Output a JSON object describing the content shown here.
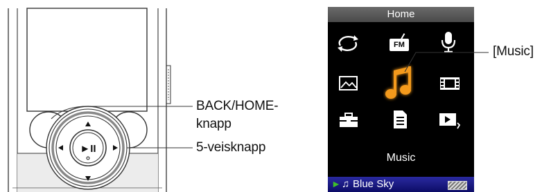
{
  "device": {
    "back_home_label": "BACK/HOME-",
    "back_home_label_line2": "knapp",
    "five_way_label": "5-veisknapp",
    "play_pause_symbol": "►II"
  },
  "screen": {
    "title": "Home",
    "selected_label": "Music",
    "callout": "[Music]",
    "fm_badge": "FM",
    "now_playing": {
      "play_symbol": "►",
      "note_symbol": "♫",
      "track": "Blue Sky"
    },
    "menu_icons": [
      "repeat-icon",
      "fm-radio-icon",
      "microphone-icon",
      "photo-icon",
      "music-note-icon",
      "video-film-icon",
      "settings-toolbox-icon",
      "playlist-document-icon",
      "now-playing-icon"
    ]
  },
  "colors": {
    "screen_bg": "#000000",
    "title_bar": "#5a5a5a",
    "accent_orange": "#f49a1c",
    "status_bar": "#12127a",
    "play_green": "#3fbf2a"
  }
}
